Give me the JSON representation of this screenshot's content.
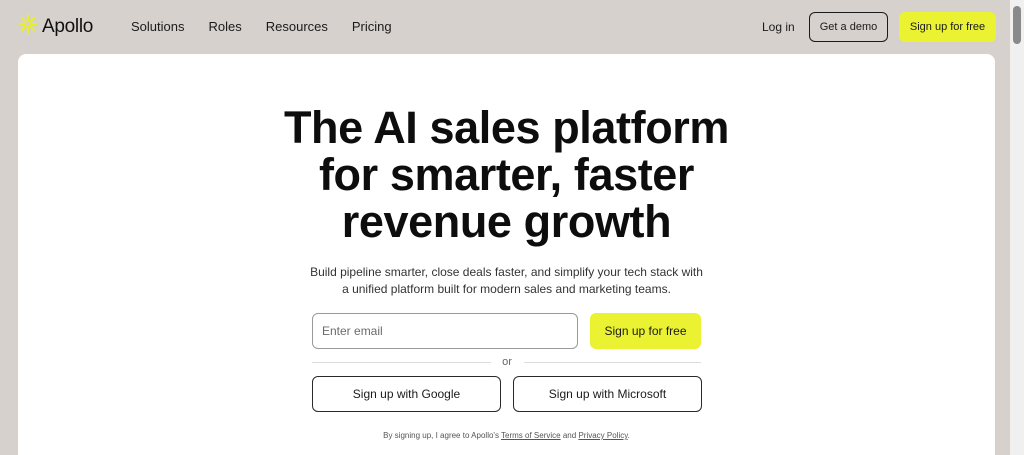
{
  "brand": {
    "name": "Apollo",
    "accent": "#eaf231",
    "logo_icon": "sunburst-icon"
  },
  "nav": {
    "links": [
      "Solutions",
      "Roles",
      "Resources",
      "Pricing"
    ],
    "login": "Log in",
    "demo": "Get a demo",
    "signup": "Sign up for free"
  },
  "hero": {
    "headline": [
      "The AI sales platform",
      "for smarter, faster",
      "revenue growth"
    ],
    "subtext": [
      "Build pipeline smarter, close deals faster, and simplify your tech stack with",
      "a unified platform built for modern sales and marketing teams."
    ],
    "email_placeholder": "Enter email",
    "signup_button": "Sign up for free",
    "or": "or",
    "google_button": "Sign up with Google",
    "microsoft_button": "Sign up with Microsoft",
    "legal_prefix": "By signing up, I agree to Apollo's",
    "terms": "Terms of Service",
    "and": "and",
    "privacy": "Privacy Policy",
    "legal_suffix": "."
  },
  "colors": {
    "background": "#d6d1cd",
    "card": "#ffffff"
  }
}
